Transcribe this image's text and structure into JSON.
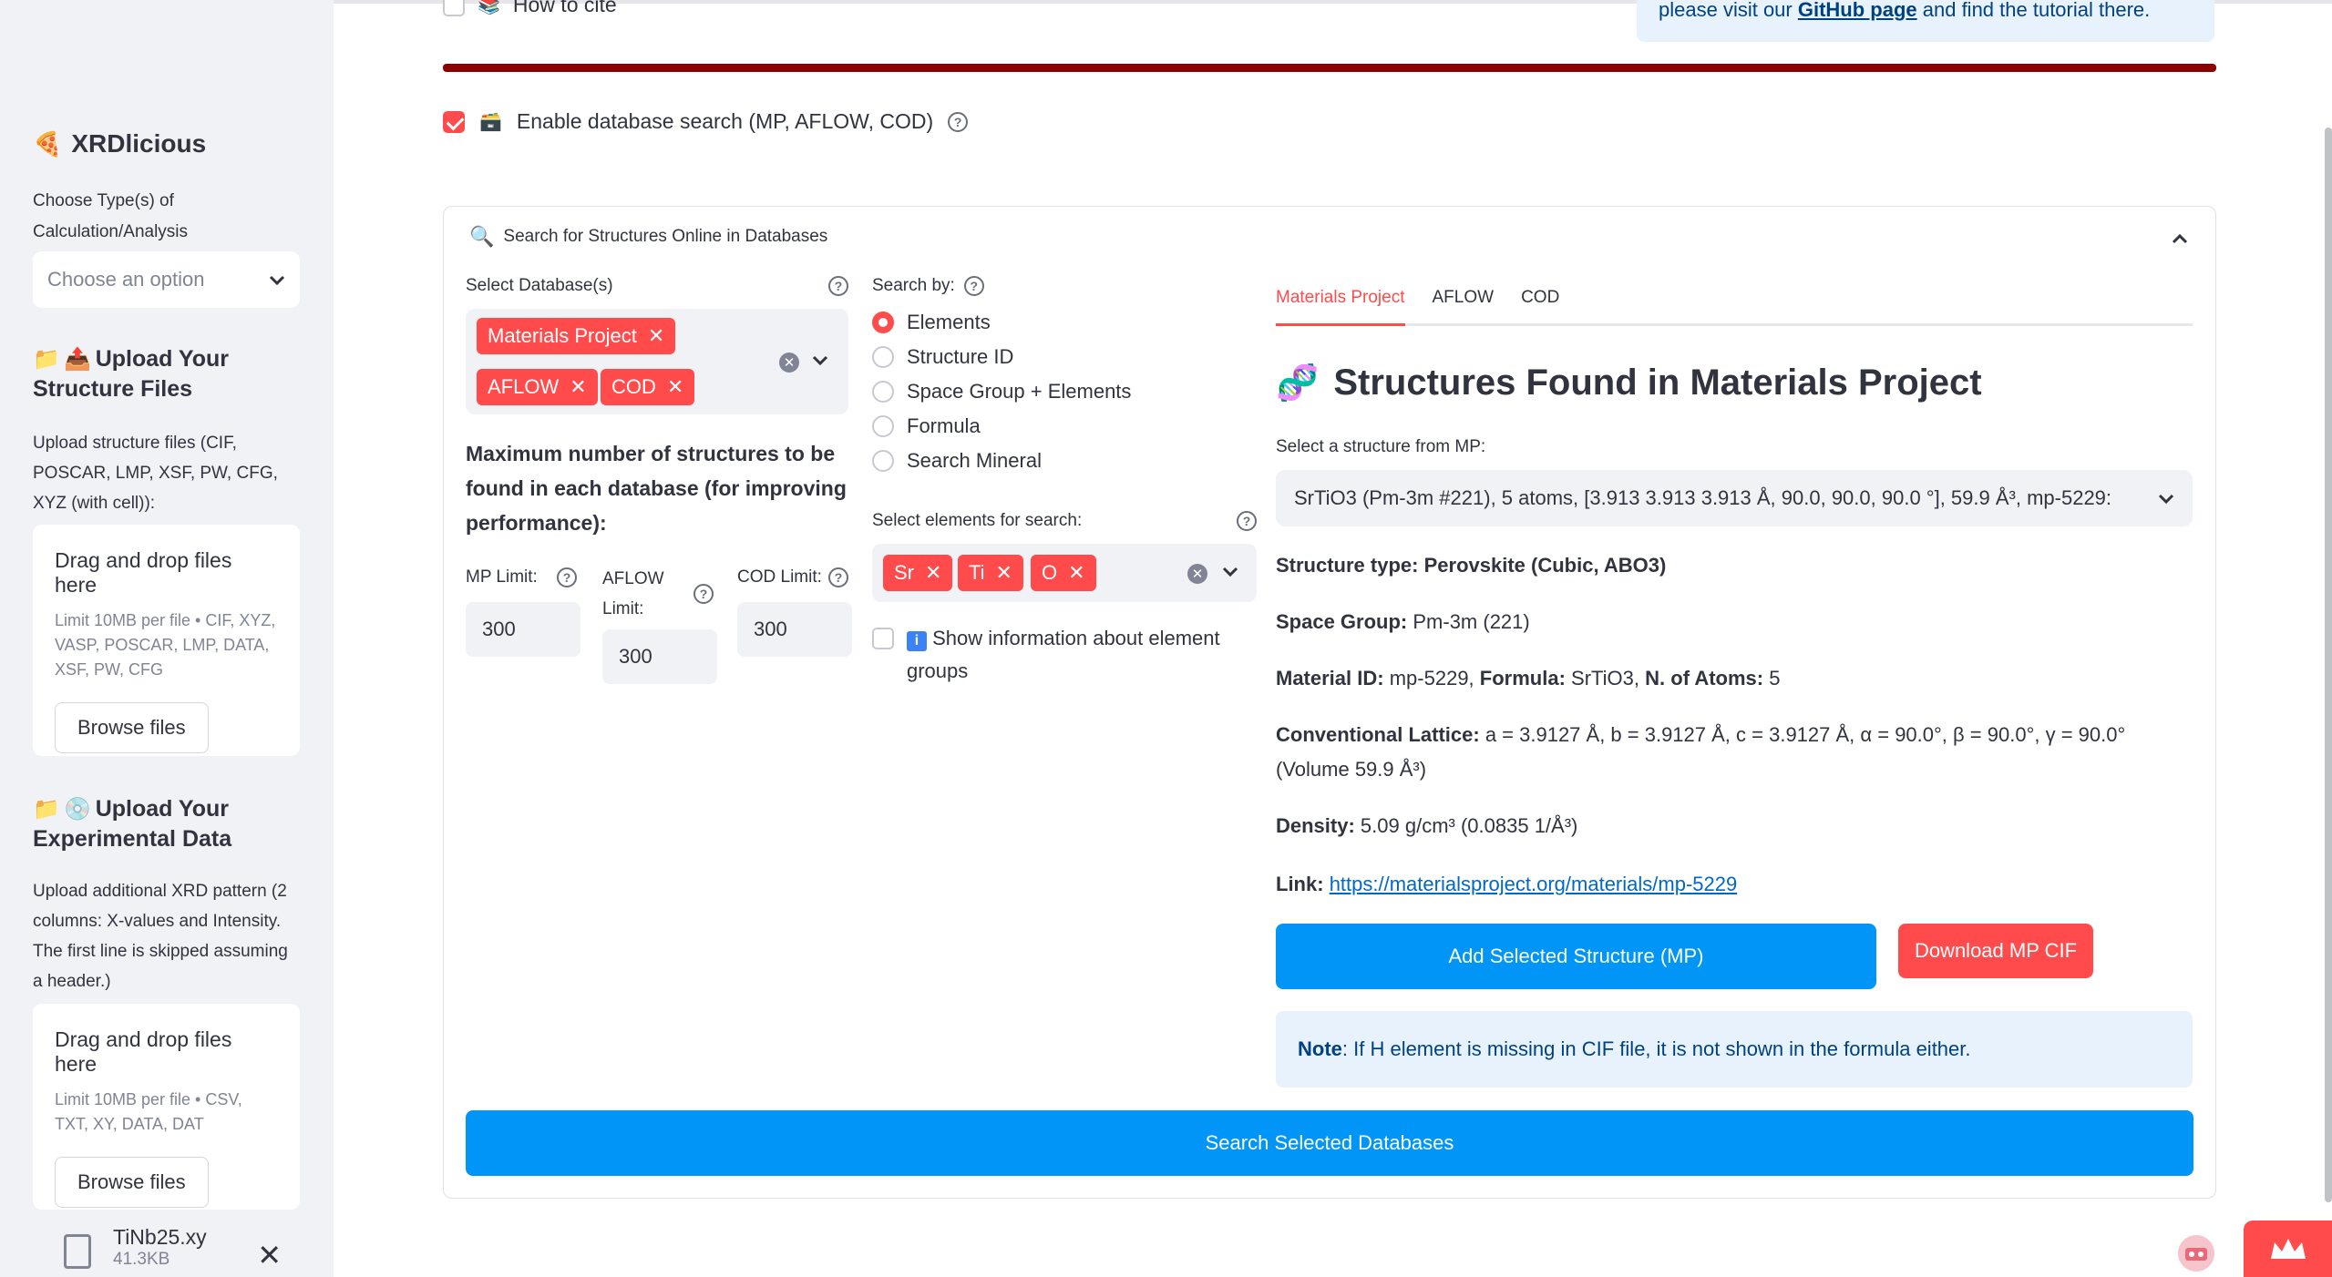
{
  "sidebar": {
    "app_title": "XRDlicious",
    "calc_label": "Choose Type(s) of Calculation/Analysis",
    "calc_placeholder": "Choose an option",
    "upload_structures": {
      "heading": "Upload Your Structure Files",
      "description": "Upload structure files (CIF, POSCAR, LMP, XSF, PW, CFG, XYZ (with cell)):",
      "drop_title": "Drag and drop files here",
      "limit_text": "Limit 10MB per file • CIF, XYZ, VASP, POSCAR, LMP, DATA, XSF, PW, CFG",
      "browse_label": "Browse files"
    },
    "upload_experimental": {
      "heading": "Upload Your Experimental Data",
      "description": "Upload additional XRD pattern (2 columns: X-values and Intensity. The first line is skipped assuming a header.)",
      "drop_title": "Drag and drop files here",
      "limit_text": "Limit 10MB per file • CSV, TXT, XY, DATA, DAT",
      "browse_label": "Browse files"
    },
    "uploaded_file": {
      "name": "TiNb25.xy",
      "size": "41.3KB"
    }
  },
  "header": {
    "cite_label": "How to cite",
    "info_text_prefix": "please visit our ",
    "info_link": "GitHub page",
    "info_text_suffix": " and find the tutorial there."
  },
  "db_toggle": {
    "label": "Enable database search (MP, AFLOW, COD)",
    "checked": true
  },
  "expander": {
    "title": "Search for Structures Online in Databases",
    "select_db_label": "Select Database(s)",
    "selected_dbs": [
      "Materials Project",
      "AFLOW",
      "COD"
    ],
    "max_label": "Maximum number of structures to be found in each database (for improving performance):",
    "mp_limit_label": "MP Limit:",
    "mp_limit_value": "300",
    "aflow_limit_label": "AFLOW Limit:",
    "aflow_limit_value": "300",
    "cod_limit_label": "COD Limit:",
    "cod_limit_value": "300",
    "search_by_label": "Search by:",
    "search_options": [
      "Elements",
      "Structure ID",
      "Space Group + Elements",
      "Formula",
      "Search Mineral"
    ],
    "search_selected": "Elements",
    "elements_label": "Select elements for search:",
    "elements": [
      "Sr",
      "Ti",
      "O"
    ],
    "show_info_label": "Show information about element groups",
    "search_button": "Search Selected Databases"
  },
  "results": {
    "tabs": [
      "Materials Project",
      "AFLOW",
      "COD"
    ],
    "active_tab": "Materials Project",
    "title": "Structures Found in Materials Project",
    "select_label": "Select a structure from MP:",
    "selected_structure": "SrTiO3 (Pm-3m #221), 5 atoms, [3.913 3.913 3.913 Å, 90.0, 90.0, 90.0 °], 59.9 Å³, mp-5229:",
    "structure_type_label": "Structure type:",
    "structure_type_value": "Perovskite (Cubic, ABO3)",
    "space_group_label": "Space Group:",
    "space_group_value": "Pm-3m (221)",
    "material_id_label": "Material ID:",
    "material_id_value": "mp-5229,",
    "formula_label": "Formula:",
    "formula_value": "SrTiO3,",
    "atoms_label": "N. of Atoms:",
    "atoms_value": "5",
    "lattice_label": "Conventional Lattice:",
    "lattice_value": "a = 3.9127 Å, b = 3.9127 Å, c = 3.9127 Å, α = 90.0°, β = 90.0°, γ = 90.0° (Volume 59.9 Å³)",
    "density_label": "Density:",
    "density_value": "5.09 g/cm³ (0.0835 1/Å³)",
    "link_label": "Link:",
    "link_value": "https://materialsproject.org/materials/mp-5229",
    "add_button": "Add Selected Structure (MP)",
    "download_button": "Download MP CIF",
    "note_label": "Note",
    "note_text": ": If H element is missing in CIF file, it is not shown in the formula either."
  },
  "colors": {
    "accent_red": "#ff4b4b",
    "primary_blue": "#0095f6",
    "dark_red_bar": "#8b0000",
    "info_bg": "#e8f2fc"
  }
}
